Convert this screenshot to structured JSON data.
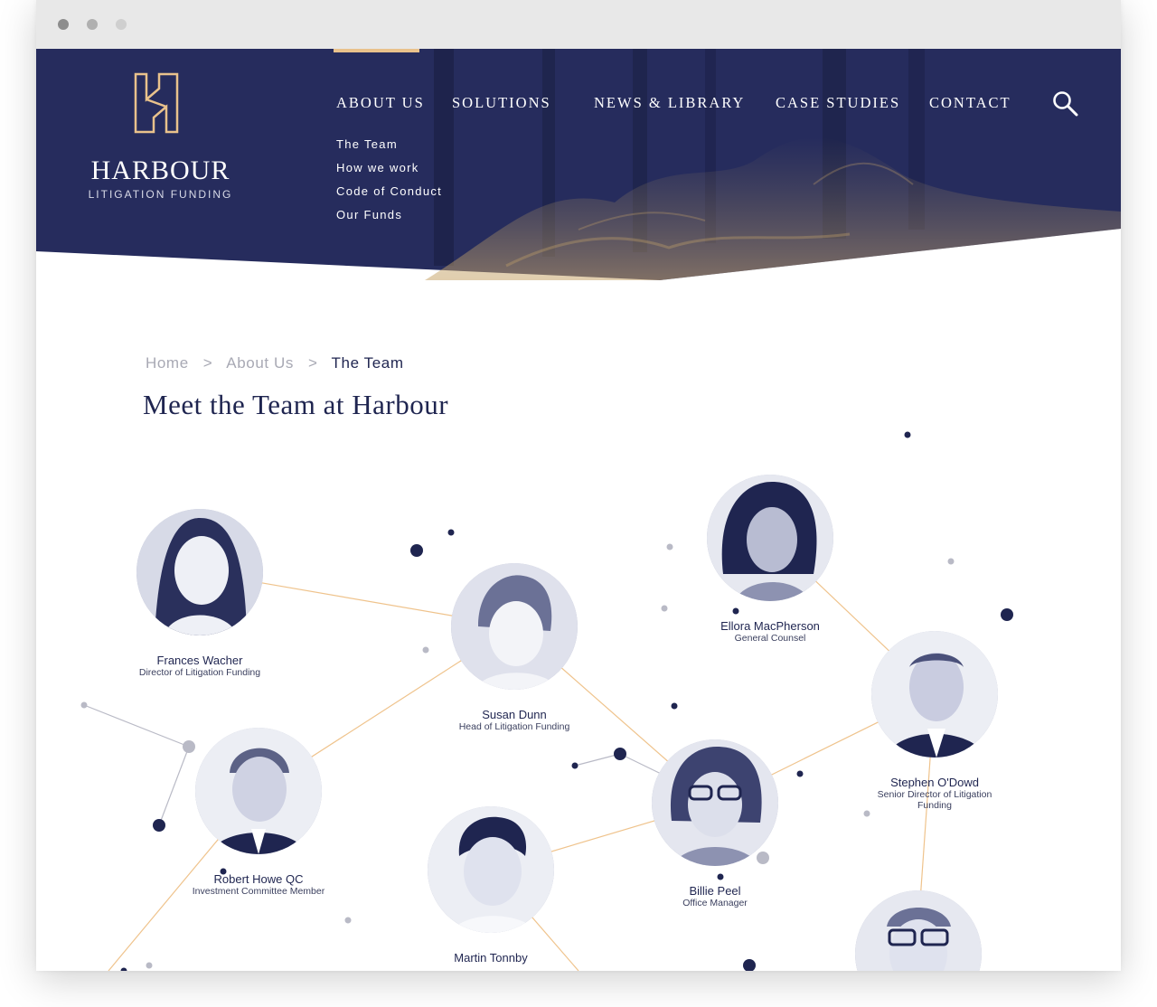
{
  "site": {
    "logo_name": "HARBOUR",
    "logo_sub": "LITIGATION FUNDING"
  },
  "nav": {
    "items": [
      {
        "label": "ABOUT US",
        "active": true
      },
      {
        "label": "SOLUTIONS"
      },
      {
        "label": "NEWS & LIBRARY"
      },
      {
        "label": "CASE STUDIES"
      },
      {
        "label": "CONTACT"
      }
    ],
    "search_icon": "search-icon",
    "submenu": [
      "The Team",
      "How we work",
      "Code of Conduct",
      "Our Funds"
    ]
  },
  "breadcrumb": {
    "home": "Home",
    "separator": ">",
    "parent": "About Us",
    "current": "The Team"
  },
  "page_title": "Meet the Team at Harbour",
  "team": [
    {
      "name": "Frances Wacher",
      "role": "Director of Litigation Funding"
    },
    {
      "name": "Susan Dunn",
      "role": "Head of Litigation Funding"
    },
    {
      "name": "Ellora MacPherson",
      "role": "General Counsel"
    },
    {
      "name": "Stephen O'Dowd",
      "role": "Senior Director of Litigation Funding"
    },
    {
      "name": "Robert Howe QC",
      "role": "Investment Committee Member"
    },
    {
      "name": "Billie Peel",
      "role": "Office Manager"
    },
    {
      "name": "Martin Tonnby",
      "role": ""
    },
    {
      "name": "",
      "role": ""
    }
  ],
  "colors": {
    "navy": "#262c5d",
    "gold_accent": "#e9c28c",
    "connector": "#efc38c",
    "text_dark": "#1f2550",
    "muted": "#a8a9b4"
  }
}
